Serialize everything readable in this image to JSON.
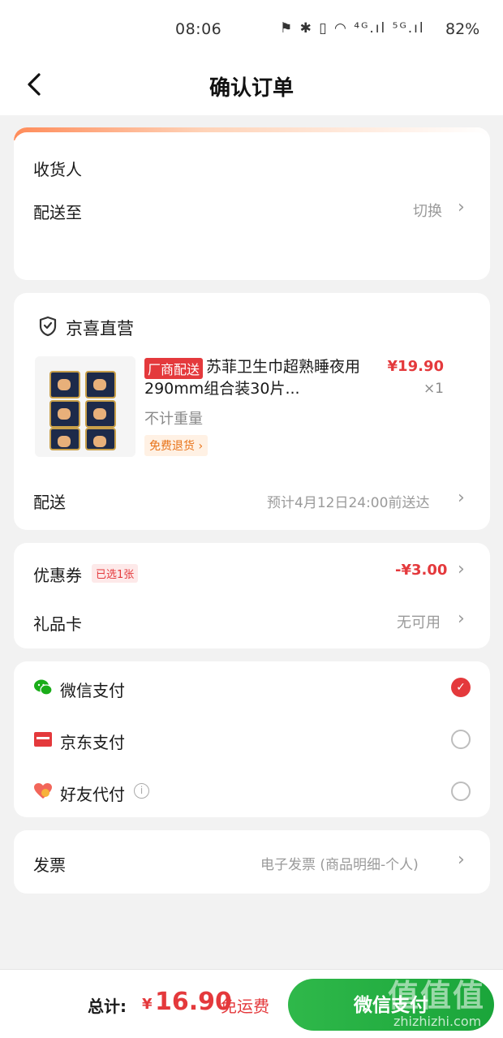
{
  "status_bar": {
    "time": "08:06",
    "icons": "⚑ ✱ ▯ ◠ ⁴ᴳ.ıl ⁵ᴳ.ıl",
    "battery": "82%"
  },
  "nav": {
    "title": "确认订单"
  },
  "address": {
    "receiver_label": "收货人",
    "deliver_to_label": "配送至",
    "switch_label": "切换"
  },
  "shop": {
    "name": "京喜直营",
    "product": {
      "tag": "厂商配送",
      "title": "苏菲卫生巾超熟睡夜用290mm组合装30片...",
      "price": "¥19.90",
      "qty": "×1",
      "weight": "不计重量",
      "return_badge": "免费退货"
    },
    "delivery_label": "配送",
    "delivery_estimate": "预计4月12日24:00前送达"
  },
  "coupon": {
    "label": "优惠券",
    "selected_badge": "已选1张",
    "discount": "-¥3.00",
    "gift_card_label": "礼品卡",
    "gift_card_value": "无可用"
  },
  "payment": {
    "options": [
      {
        "label": "微信支付",
        "selected": true
      },
      {
        "label": "京东支付",
        "selected": false
      },
      {
        "label": "好友代付",
        "selected": false
      }
    ],
    "info_icon": "i"
  },
  "invoice": {
    "label": "发票",
    "value": "电子发票 (商品明细-个人)"
  },
  "bottom": {
    "total_label": "总计:",
    "currency": "¥",
    "total_amount": "16.90",
    "free_shipping": "免运费",
    "pay_button": "微信支付"
  },
  "watermark": {
    "big": "值值值",
    "small": "zhizhizhi.com"
  },
  "colors": {
    "accent_red": "#e4393c",
    "wechat_green": "#1aa53a",
    "orange_badge": "#e8731a"
  }
}
